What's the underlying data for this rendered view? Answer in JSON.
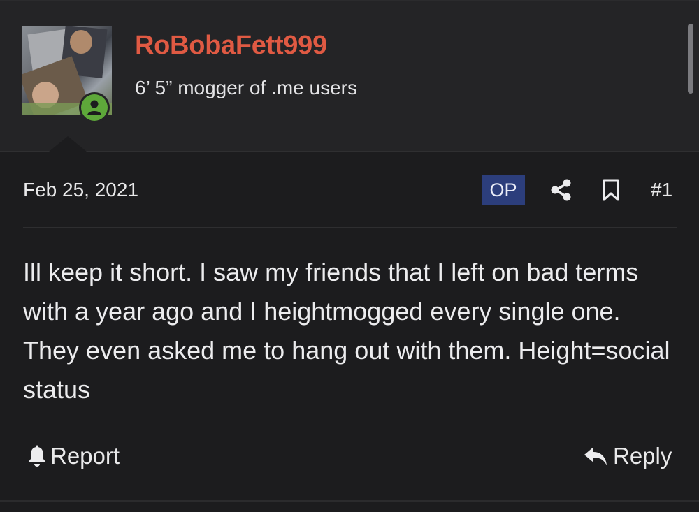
{
  "author": {
    "username": "RoBobaFett999",
    "user_title": "6’ 5” mogger of .me users",
    "status": "online"
  },
  "post": {
    "date": "Feb 25, 2021",
    "op_badge": "OP",
    "number": "#1",
    "body": "Ill keep it short. I saw my friends that I left on bad terms with a year ago and I heightmogged every single one. They even asked me to hang out with them. Height=social status"
  },
  "actions": {
    "report_label": "Report",
    "reply_label": "Reply"
  },
  "icons": {
    "share": "share-icon",
    "bookmark": "bookmark-icon",
    "report": "bell-icon",
    "reply": "reply-arrow-icon",
    "status": "user-online-icon"
  },
  "colors": {
    "username": "#e05a43",
    "op_badge_bg": "#2c3e7c",
    "status_online": "#5ea83a",
    "background": "#1c1c1e"
  }
}
